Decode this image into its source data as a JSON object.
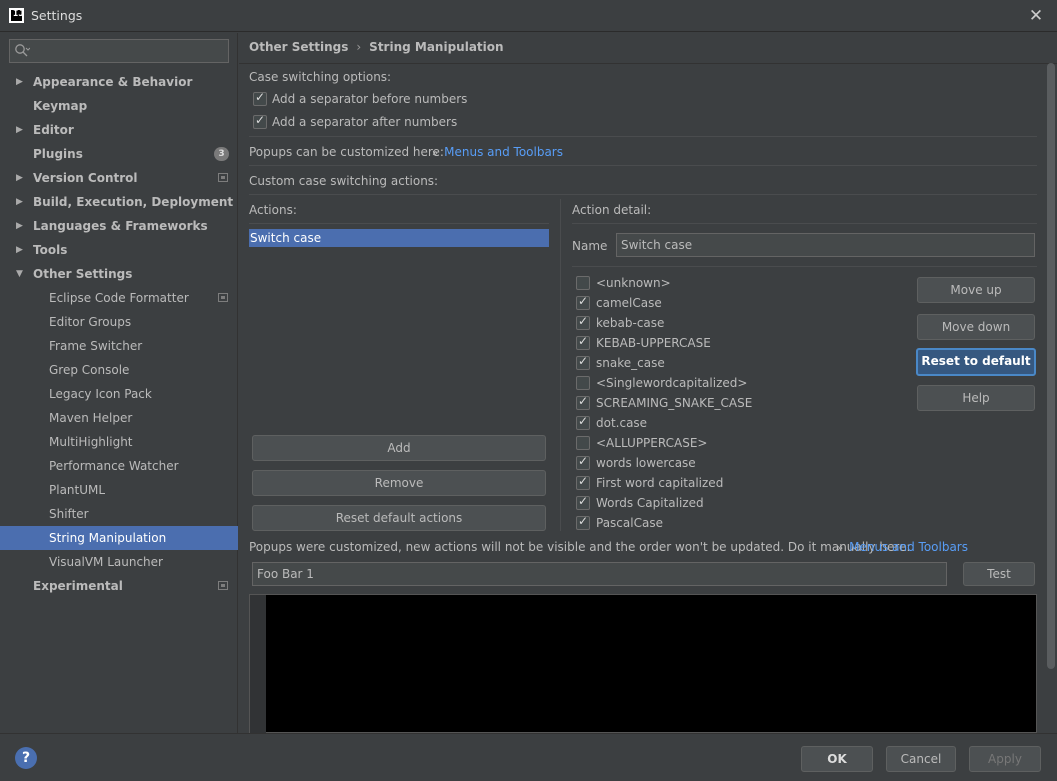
{
  "window": {
    "title": "Settings",
    "app_logo_text": "IJ"
  },
  "search": {
    "placeholder": ""
  },
  "sidebar": {
    "items": [
      {
        "label": "Appearance & Behavior",
        "arrow": "▶",
        "bold": true
      },
      {
        "label": "Keymap",
        "arrow": "",
        "bold": true
      },
      {
        "label": "Editor",
        "arrow": "▶",
        "bold": true
      },
      {
        "label": "Plugins",
        "arrow": "",
        "bold": true,
        "badge": "3"
      },
      {
        "label": "Version Control",
        "arrow": "▶",
        "bold": true,
        "project_icon": true
      },
      {
        "label": "Build, Execution, Deployment",
        "arrow": "▶",
        "bold": true
      },
      {
        "label": "Languages & Frameworks",
        "arrow": "▶",
        "bold": true
      },
      {
        "label": "Tools",
        "arrow": "▶",
        "bold": true
      },
      {
        "label": "Other Settings",
        "arrow": "▼",
        "bold": true
      },
      {
        "label": "Eclipse Code Formatter",
        "project_icon": true
      },
      {
        "label": "Editor Groups"
      },
      {
        "label": "Frame Switcher"
      },
      {
        "label": "Grep Console"
      },
      {
        "label": "Legacy Icon Pack"
      },
      {
        "label": "Maven Helper"
      },
      {
        "label": "MultiHighlight"
      },
      {
        "label": "Performance Watcher"
      },
      {
        "label": "PlantUML"
      },
      {
        "label": "Shifter"
      },
      {
        "label": "String Manipulation",
        "selected": true
      },
      {
        "label": "VisualVM Launcher"
      },
      {
        "label": "Experimental",
        "bold": true,
        "project_icon": true
      }
    ]
  },
  "breadcrumb": {
    "parent": "Other Settings",
    "separator": "›",
    "current": "String Manipulation"
  },
  "case_options": {
    "heading": "Case switching options:",
    "sep_before": "Add a separator before numbers",
    "sep_after": "Add a separator after numbers"
  },
  "popups": {
    "text": "Popups can be customized here:",
    "link": "Menus and Toolbars",
    "chevron": "»"
  },
  "custom": {
    "heading": "Custom case switching actions:",
    "actions_label": "Actions:",
    "detail_label": "Action detail:",
    "actions": [
      "Switch case"
    ],
    "name_label": "Name",
    "name_value": "Switch case",
    "add": "Add",
    "remove": "Remove",
    "reset_actions": "Reset default actions"
  },
  "cases": [
    {
      "label": "<unknown>",
      "checked": false
    },
    {
      "label": "camelCase",
      "checked": true
    },
    {
      "label": "kebab-case",
      "checked": true
    },
    {
      "label": "KEBAB-UPPERCASE",
      "checked": true
    },
    {
      "label": "snake_case",
      "checked": true
    },
    {
      "label": "<Singlewordcapitalized>",
      "checked": false
    },
    {
      "label": "SCREAMING_SNAKE_CASE",
      "checked": true
    },
    {
      "label": "dot.case",
      "checked": true
    },
    {
      "label": "<ALLUPPERCASE>",
      "checked": false
    },
    {
      "label": "words lowercase",
      "checked": true
    },
    {
      "label": "First word capitalized",
      "checked": true
    },
    {
      "label": "Words Capitalized",
      "checked": true
    },
    {
      "label": "PascalCase",
      "checked": true
    }
  ],
  "detail_buttons": {
    "move_up": "Move up",
    "move_down": "Move down",
    "reset": "Reset to default",
    "help": "Help"
  },
  "notice": {
    "text": "Popups were customized, new actions will not be visible and the order won't be updated. Do it manually here:",
    "link": "Menus and Toolbars"
  },
  "test": {
    "input_value": "Foo Bar 1",
    "button": "Test"
  },
  "footer": {
    "help": "?",
    "ok": "OK",
    "cancel": "Cancel",
    "apply": "Apply"
  }
}
